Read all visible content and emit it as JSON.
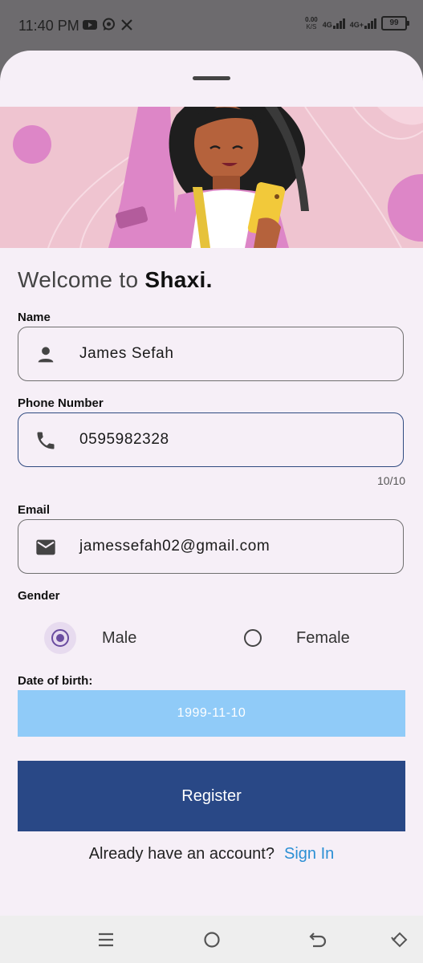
{
  "status_bar": {
    "time": "11:40 PM",
    "left_icons": [
      "youtube-icon",
      "whatsapp-icon",
      "x-icon"
    ],
    "net_speed_value": "0.00",
    "net_speed_unit": "K/S",
    "network_1": "4G",
    "network_2": "4G+",
    "battery": "99"
  },
  "header": {
    "welcome_prefix": "Welcome to ",
    "app_name": "Shaxi."
  },
  "form": {
    "name_label": "Name",
    "name_value": "James Sefah",
    "phone_label": "Phone Number",
    "phone_value": "0595982328",
    "phone_counter": "10/10",
    "email_label": "Email",
    "email_value": "jamessefah02@gmail.com",
    "gender_label": "Gender",
    "gender_options": [
      "Male",
      "Female"
    ],
    "gender_selected": "Male",
    "dob_label": "Date of birth:",
    "dob_value": "1999-11-10",
    "register_label": "Register",
    "signin_prompt": "Already have an account?",
    "signin_link": "Sign In"
  },
  "nav_bar": {
    "icons": [
      "menu-icon",
      "home-icon",
      "back-icon",
      "rotate-icon"
    ]
  },
  "colors": {
    "sheet_bg": "#f6eff7",
    "banner_bg": "#efc4d0",
    "dob_bg": "#90cbf8",
    "register_bg": "#294886",
    "link": "#2b8fd4",
    "radio_selected": "#6a4ca0"
  }
}
